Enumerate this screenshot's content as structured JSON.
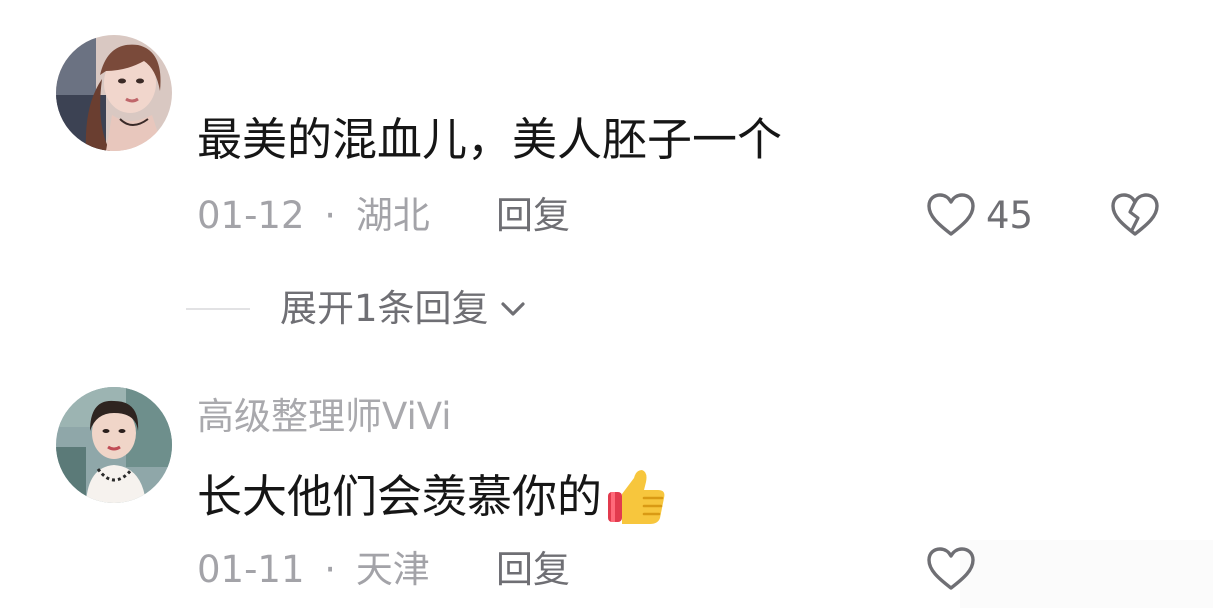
{
  "comments": [
    {
      "username": "",
      "text": "最美的混血儿，美人胚子一个",
      "date": "01-12",
      "location": "湖北",
      "separator": "·",
      "reply_label": "回复",
      "like_count": "45",
      "avatar_icon": "user-avatar-woman-photo",
      "expand_replies_label": "展开1条回复"
    },
    {
      "username": "高级整理师ViVi",
      "text": "长大他们会羡慕你的",
      "emoji": "thumbs-up-icon",
      "date": "01-11",
      "location": "天津",
      "separator": "·",
      "reply_label": "回复",
      "like_count": "",
      "avatar_icon": "user-avatar-woman-photo"
    }
  ],
  "colors": {
    "text_primary": "#161616",
    "text_secondary": "#a3a3a8",
    "text_action": "#6f6f74",
    "icon_stroke": "#6f6f74"
  }
}
